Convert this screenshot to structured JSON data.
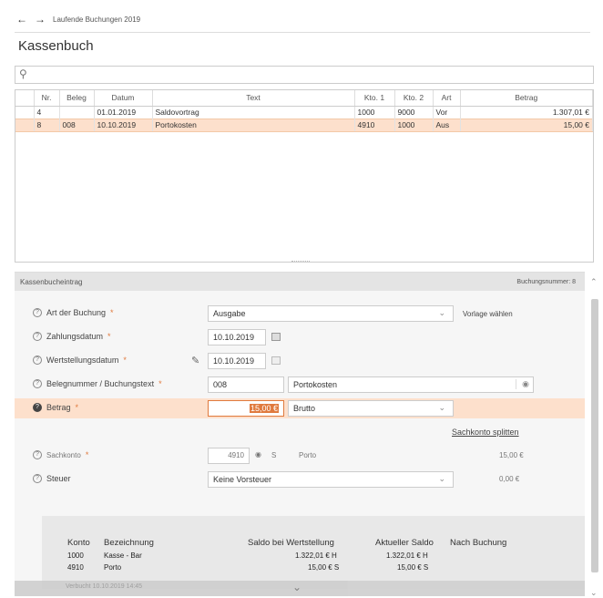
{
  "breadcrumb": {
    "back": "←",
    "forward": "→",
    "label": "Laufende Buchungen 2019"
  },
  "page_title": "Kassenbuch",
  "search": {
    "placeholder": ""
  },
  "table": {
    "headers": [
      "Nr.",
      "Beleg",
      "Datum",
      "Text",
      "Kto. 1",
      "Kto. 2",
      "Art",
      "Betrag"
    ],
    "rows": [
      {
        "nr": "4",
        "beleg": "",
        "datum": "01.01.2019",
        "text": "Saldovortrag",
        "kto1": "1000",
        "kto2": "9000",
        "art": "Vor",
        "betrag": "1.307,01 €"
      },
      {
        "nr": "8",
        "beleg": "008",
        "datum": "10.10.2019",
        "text": "Portokosten",
        "kto1": "4910",
        "kto2": "1000",
        "art": "Aus",
        "betrag": "15,00 €"
      }
    ]
  },
  "form": {
    "title": "Kassenbucheintrag",
    "booking_number": "Buchungsnummer: 8",
    "art": {
      "label": "Art der Buchung",
      "req": "*",
      "value": "Ausgabe",
      "template": "Vorlage wählen"
    },
    "zahlungsdatum": {
      "label": "Zahlungsdatum",
      "req": "*",
      "value": "10.10.2019"
    },
    "wertstellung": {
      "label": "Wertstellungsdatum",
      "req": "*",
      "value": "10.10.2019"
    },
    "beleg": {
      "label": "Belegnummer / Buchungstext",
      "req": "*",
      "number": "008",
      "text": "Portokosten"
    },
    "betrag": {
      "label": "Betrag",
      "req": "*",
      "value": "15,00 €",
      "type": "Brutto"
    },
    "split_link": "Sachkonto splitten",
    "sachkonto": {
      "label": "Sachkonto",
      "req": "*",
      "value": "4910",
      "side": "S",
      "name": "Porto",
      "amount": "15,00 €"
    },
    "steuer": {
      "label": "Steuer",
      "value": "Keine Vorsteuer",
      "amount": "0,00 €"
    }
  },
  "saldo": {
    "headers": {
      "konto": "Konto",
      "bez": "Bezeichnung",
      "wert": "Saldo bei Wertstellung",
      "akt": "Aktueller Saldo",
      "nach": "Nach Buchung"
    },
    "rows": [
      {
        "konto": "1000",
        "bez": "Kasse - Bar",
        "wert": "1.322,01 € H",
        "akt": "1.322,01 € H"
      },
      {
        "konto": "4910",
        "bez": "Porto",
        "wert": "15,00 € S",
        "akt": "15,00 € S"
      }
    ]
  },
  "footer": {
    "version": "Verbucht 10.10.2019 14:45"
  },
  "colors": {
    "highlight": "#fde0cc",
    "accent": "#e07a3e"
  }
}
